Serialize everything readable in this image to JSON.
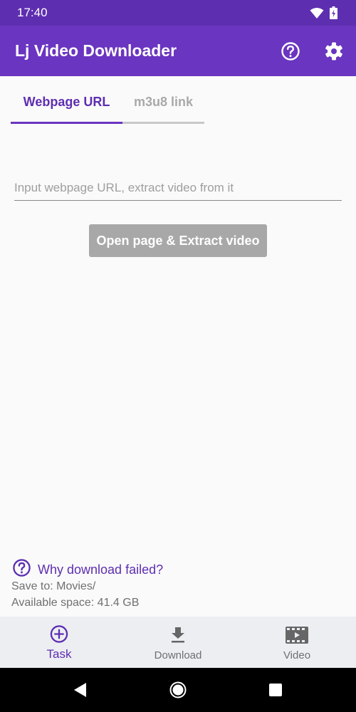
{
  "status_bar": {
    "time": "17:40",
    "icons": [
      "wifi-icon",
      "battery-icon"
    ]
  },
  "app_bar": {
    "title": "Lj Video Downloader",
    "actions": [
      "help-icon",
      "settings-icon"
    ]
  },
  "tabs": [
    {
      "label": "Webpage URL",
      "selected": true
    },
    {
      "label": "m3u8 link",
      "selected": false
    }
  ],
  "url_input": {
    "value": "",
    "placeholder": "Input webpage URL, extract video from it"
  },
  "extract_button": {
    "label": "Open page & Extract video"
  },
  "help_link": {
    "label": "Why download failed?",
    "icon": "help-circle-icon"
  },
  "info": {
    "save_to": "Save to: Movies/",
    "available_space": "Available space: 41.4 GB"
  },
  "bottom_nav": [
    {
      "label": "Task",
      "icon": "add-circle-icon",
      "selected": true
    },
    {
      "label": "Download",
      "icon": "download-icon",
      "selected": false
    },
    {
      "label": "Video",
      "icon": "film-icon",
      "selected": false
    }
  ],
  "system_nav": [
    "back-icon",
    "home-icon",
    "recents-icon"
  ],
  "colors": {
    "primary": "#6a35c0",
    "primary_dark": "#5e2eb0",
    "button_disabled": "#a8a8a8",
    "background": "#fafafa",
    "bottom_nav_bg": "#eceef2"
  }
}
